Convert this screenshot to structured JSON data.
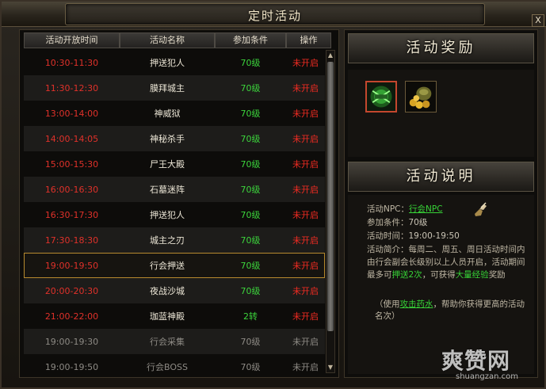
{
  "window": {
    "title": "定时活动",
    "close_label": "X"
  },
  "table": {
    "headers": [
      "活动开放时间",
      "活动名称",
      "参加条件",
      "操作"
    ],
    "rows": [
      {
        "time": "10:30-11:30",
        "name": "押送犯人",
        "cond": "70级",
        "status": "未开启",
        "style": "red"
      },
      {
        "time": "11:30-12:30",
        "name": "膜拜城主",
        "cond": "70级",
        "status": "未开启",
        "style": "red"
      },
      {
        "time": "13:00-14:00",
        "name": "神威狱",
        "cond": "70级",
        "status": "未开启",
        "style": "red"
      },
      {
        "time": "14:00-14:05",
        "name": "神秘杀手",
        "cond": "70级",
        "status": "未开启",
        "style": "red"
      },
      {
        "time": "15:00-15:30",
        "name": "尸王大殿",
        "cond": "70级",
        "status": "未开启",
        "style": "red"
      },
      {
        "time": "16:00-16:30",
        "name": "石墓迷阵",
        "cond": "70级",
        "status": "未开启",
        "style": "red"
      },
      {
        "time": "16:30-17:30",
        "name": "押送犯人",
        "cond": "70级",
        "status": "未开启",
        "style": "red"
      },
      {
        "time": "17:30-18:30",
        "name": "城主之刃",
        "cond": "70级",
        "status": "未开启",
        "style": "red"
      },
      {
        "time": "19:00-19:50",
        "name": "行会押送",
        "cond": "70级",
        "status": "未开启",
        "style": "red",
        "selected": true
      },
      {
        "time": "20:00-20:30",
        "name": "夜战沙城",
        "cond": "70级",
        "status": "未开启",
        "style": "red"
      },
      {
        "time": "21:00-22:00",
        "name": "珈蓝神殿",
        "cond": "2转",
        "status": "未开启",
        "style": "red"
      },
      {
        "time": "19:00-19:30",
        "name": "行会采集",
        "cond": "70级",
        "status": "未开启",
        "style": "grey"
      },
      {
        "time": "19:00-19:50",
        "name": "行会BOSS",
        "cond": "70级",
        "status": "未开启",
        "style": "grey"
      }
    ]
  },
  "reward": {
    "heading": "活动奖励",
    "items": [
      {
        "icon": "exp-scroll-icon",
        "selected": true
      },
      {
        "icon": "gold-pouch-icon",
        "selected": false
      }
    ]
  },
  "description": {
    "heading": "活动说明",
    "npc_label": "活动NPC：",
    "npc_value": "行会NPC",
    "cond_label": "参加条件：",
    "cond_value": "70级",
    "time_label": "活动时间：",
    "time_value": "19:00-19:50",
    "intro_label": "活动简介：",
    "intro_part1": "每周二、周五、周日活动时间内由行会副会长级别以上人员开启，活动期间最多可",
    "intro_green1": "押送2次",
    "intro_part2": "，可获得",
    "intro_green2": "大量经验",
    "intro_part3": "奖励",
    "tip_prefix": "（使用",
    "tip_link": "攻击药水",
    "tip_suffix": "，帮助你获得更高的活动名次）"
  },
  "watermark": {
    "big": "爽赞网",
    "small": "shuangzan.com"
  },
  "colors": {
    "red": "#e0312a",
    "green": "#3cd43c",
    "grey": "#8d8a84",
    "highlight": "#b78a2e"
  }
}
